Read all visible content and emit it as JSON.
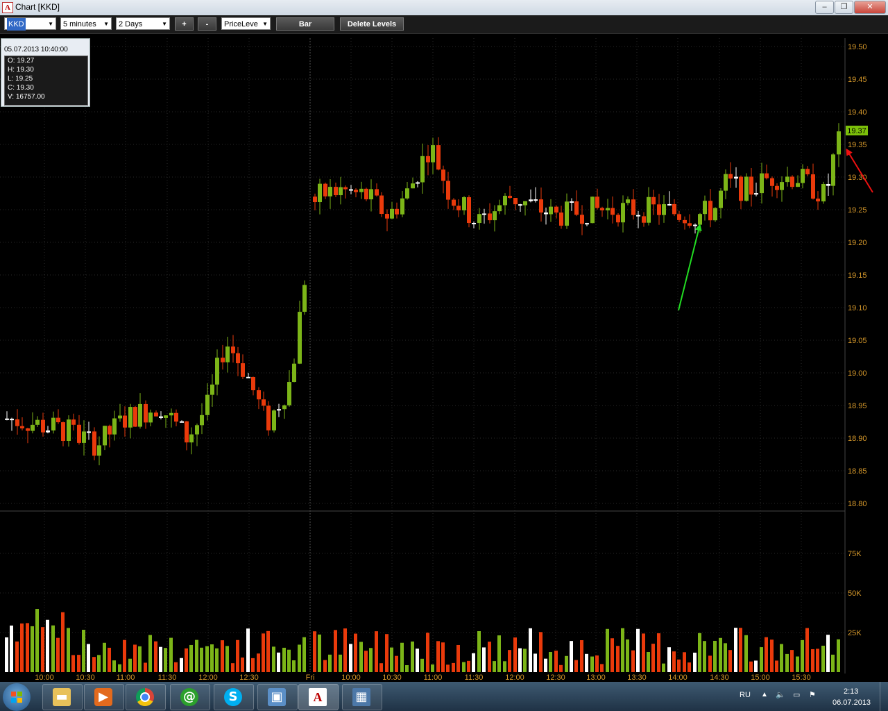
{
  "window": {
    "title": "Chart [KKD]",
    "app_icon": "A"
  },
  "toolbar": {
    "symbol": "KKD",
    "interval": "5 minutes",
    "range": "2 Days",
    "zoom_in": "+",
    "zoom_out": "-",
    "level_type": "PriceLeve",
    "chart_type": "Bar",
    "delete_levels": "Delete Levels"
  },
  "info_box": {
    "datetime": "05.07.2013 10:40:00",
    "open": "O: 19.27",
    "high": "H: 19.30",
    "low": "L: 19.25",
    "close": "C: 19.30",
    "volume": "V: 16757.00"
  },
  "price_axis": {
    "labels": [
      "19.50",
      "19.45",
      "19.40",
      "19.35",
      "19.30",
      "19.25",
      "19.20",
      "19.15",
      "19.10",
      "19.05",
      "19.00",
      "18.95",
      "18.90",
      "18.85",
      "18.80"
    ],
    "current_price": "19.37",
    "current_price_color": "#7cc00a"
  },
  "volume_axis": {
    "labels": [
      "75K",
      "50K",
      "25K"
    ]
  },
  "time_axis": {
    "labels": [
      "10:00",
      "10:30",
      "11:00",
      "11:30",
      "12:00",
      "12:30",
      "Fri",
      "10:00",
      "10:30",
      "11:00",
      "11:30",
      "12:00",
      "12:30",
      "13:00",
      "13:30",
      "14:00",
      "14:30",
      "15:00",
      "15:30"
    ]
  },
  "colors": {
    "up": "#7cb518",
    "down": "#ea3a0b",
    "flat": "#ffffff",
    "grid": "#2a2a2a"
  },
  "annotations": {
    "green_arrow_color": "#22dd22",
    "red_arrow_color": "#ee1111"
  },
  "taskbar": {
    "apps": [
      "folder-icon",
      "media-player-icon",
      "chrome-icon",
      "mail-agent-icon",
      "skype-icon",
      "picture-viewer-icon",
      "chart-app-icon",
      "window-app-icon"
    ],
    "language": "RU",
    "time": "2:13",
    "date": "06.07.2013"
  }
}
